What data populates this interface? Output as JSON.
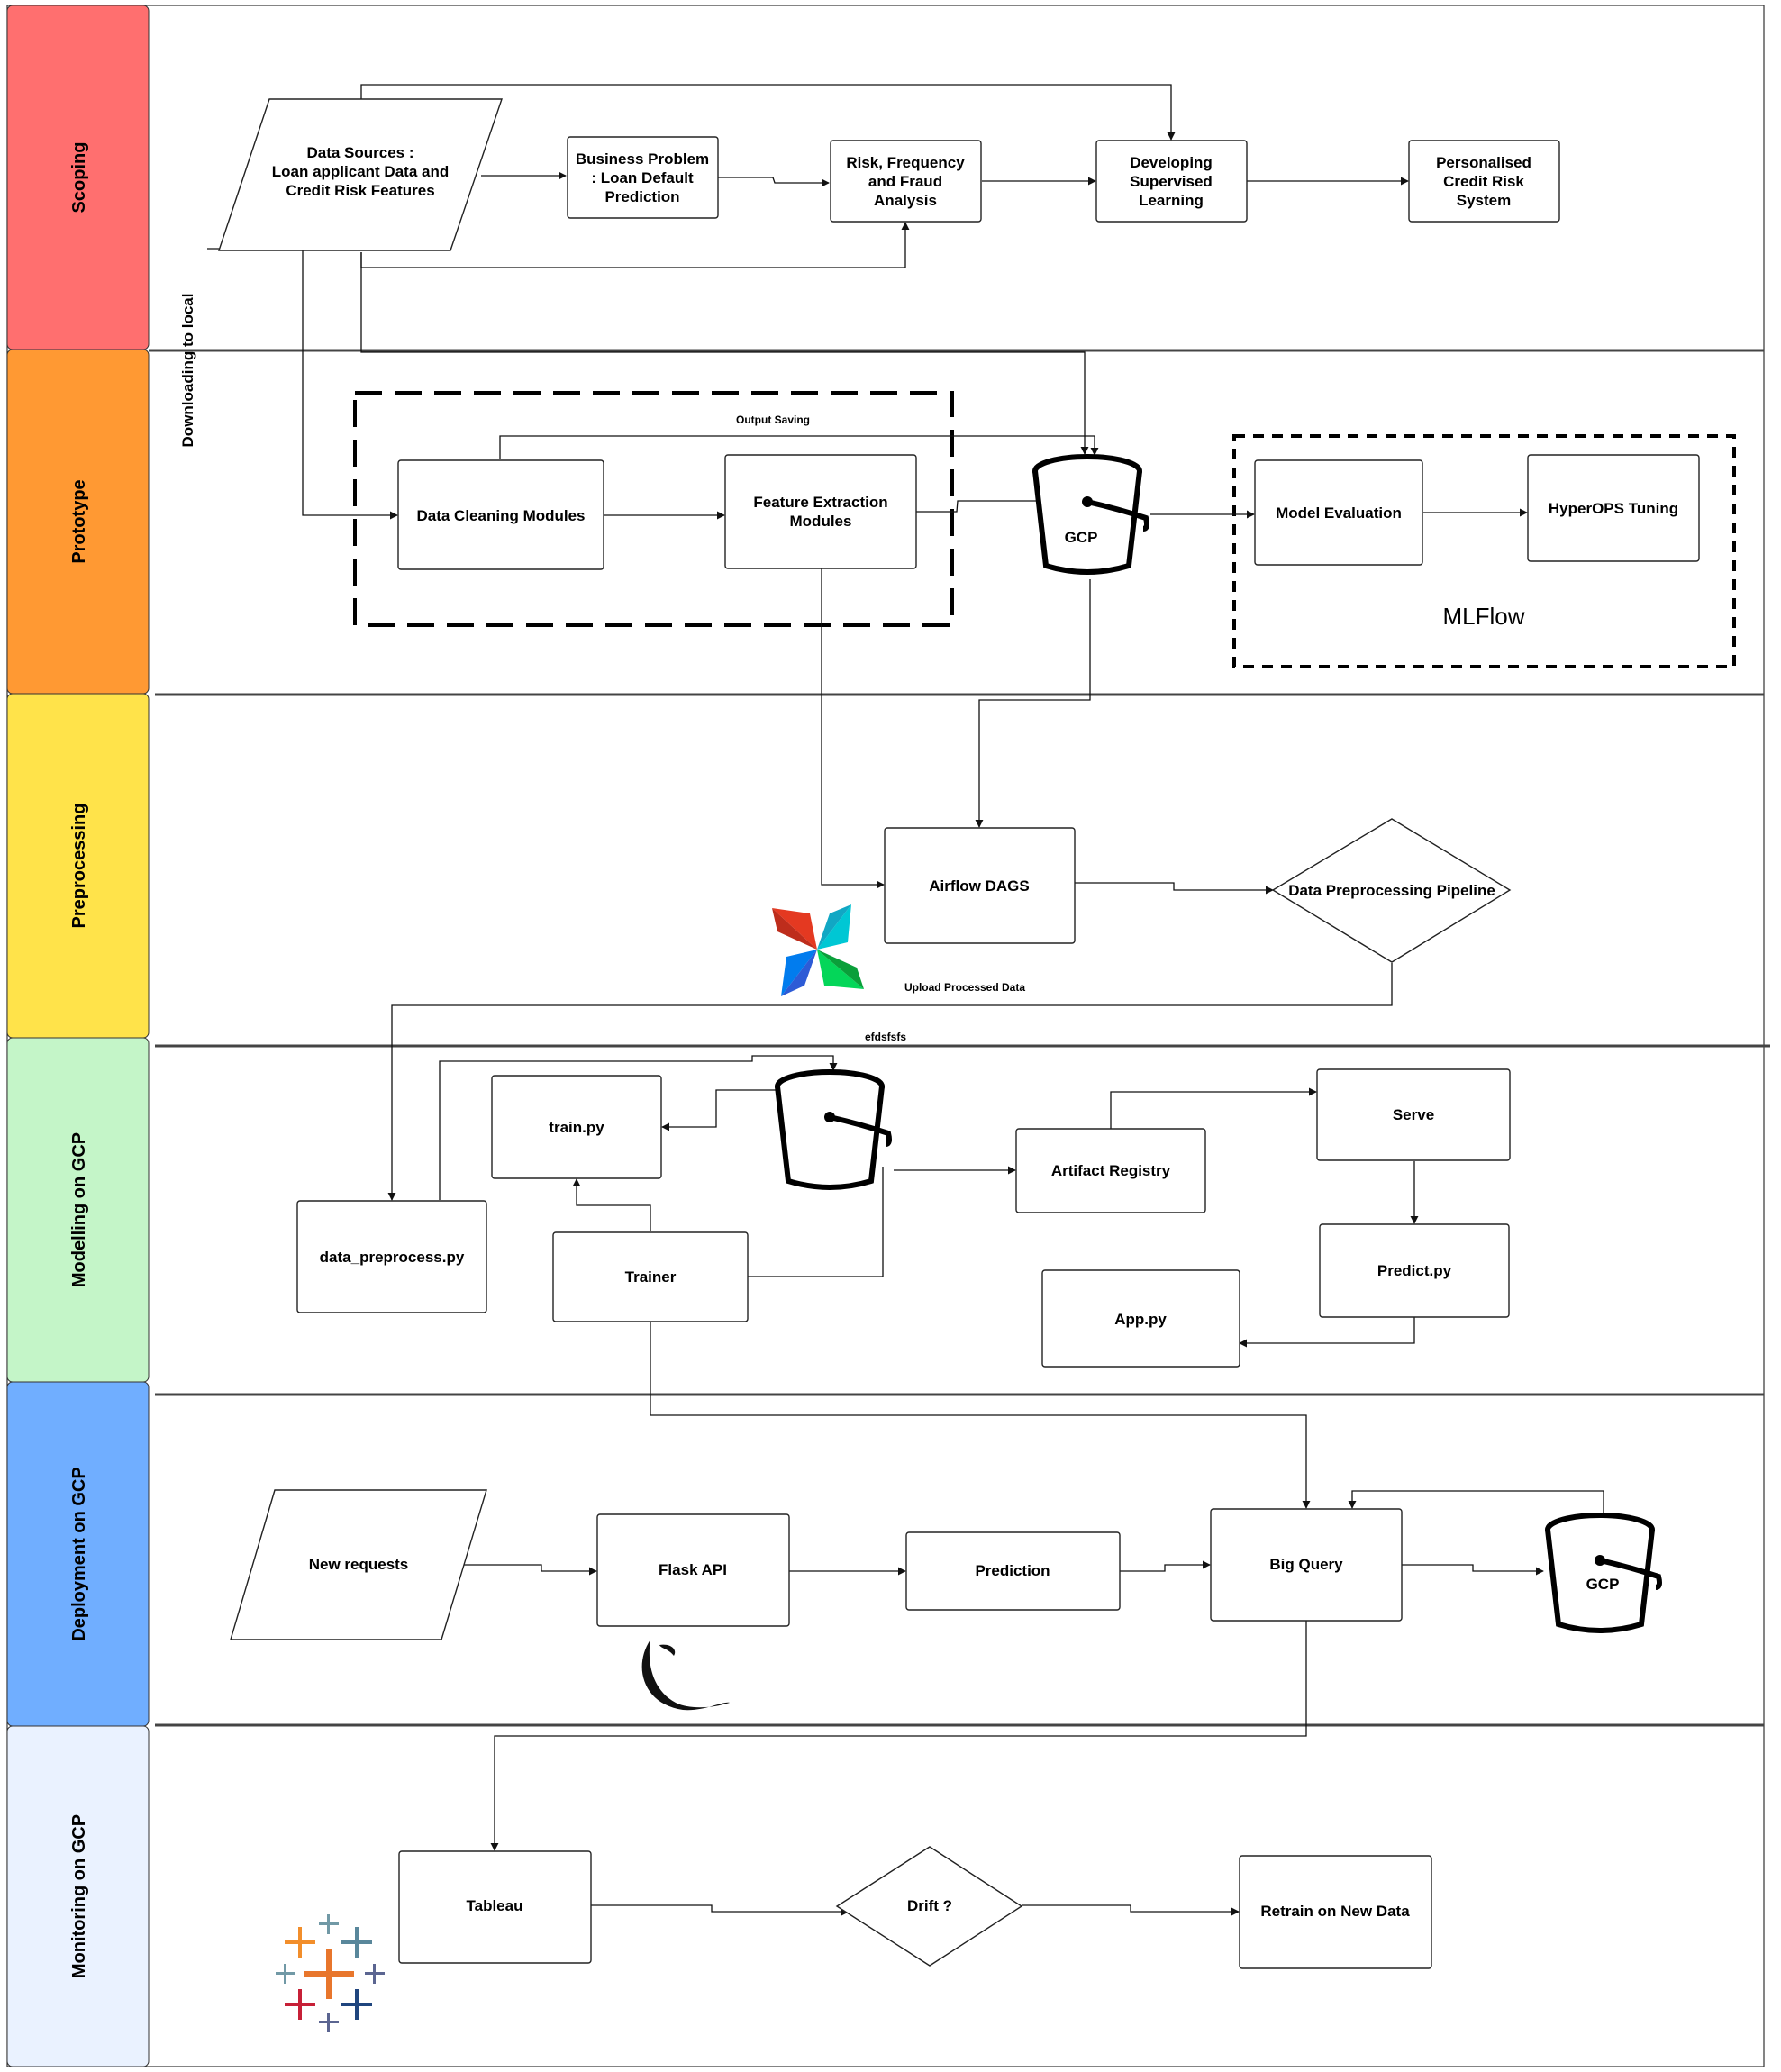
{
  "lanes": [
    {
      "id": "scoping",
      "label": "Scoping",
      "color": "#ff6f6f"
    },
    {
      "id": "prototype",
      "label": "Prototype",
      "color": "#ff9933"
    },
    {
      "id": "preprocessing",
      "label": "Preprocessing",
      "color": "#ffe34a"
    },
    {
      "id": "modelling",
      "label": "Modelling on GCP",
      "color": "#c4f5c8"
    },
    {
      "id": "deployment",
      "label": "Deployment on GCP",
      "color": "#70aeff"
    },
    {
      "id": "monitoring",
      "label": "Monitoring on GCP",
      "color": "#eaf2ff"
    }
  ],
  "nodes": {
    "data_sources": [
      "Data Sources :",
      "Loan applicant Data and",
      "Credit Risk Features"
    ],
    "business_problem": [
      "Business Problem",
      ": Loan Default",
      "Prediction"
    ],
    "risk_analysis": [
      "Risk, Frequency",
      "and Fraud",
      "Analysis"
    ],
    "supervised_learning": [
      "Developing",
      "Supervised",
      "Learning"
    ],
    "credit_risk_system": [
      "Personalised",
      "Credit Risk",
      "System"
    ],
    "data_cleaning": [
      "Data Cleaning Modules"
    ],
    "feature_extraction": [
      "Feature Extraction",
      "Modules"
    ],
    "gcp_bucket_1": [
      "GCP"
    ],
    "model_evaluation": [
      "Model Evaluation"
    ],
    "hyperops_tuning": [
      "HyperOPS Tuning"
    ],
    "airflow_dags": [
      "Airflow DAGS"
    ],
    "preprocessing_pipeline": [
      "Data Preprocessing Pipeline"
    ],
    "data_preprocess_py": [
      "data_preprocess.py"
    ],
    "train_py": [
      "train.py"
    ],
    "trainer": [
      "Trainer"
    ],
    "artifact_registry": [
      "Artifact Registry"
    ],
    "serve": [
      "Serve"
    ],
    "predict_py": [
      "Predict.py"
    ],
    "app_py": [
      "App.py"
    ],
    "new_requests": [
      "New requests"
    ],
    "flask_api": [
      "Flask API"
    ],
    "prediction": [
      "Prediction"
    ],
    "big_query": [
      "Big Query"
    ],
    "gcp_bucket_2": [
      "GCP"
    ],
    "tableau": [
      "Tableau"
    ],
    "drift": [
      "Drift ?"
    ],
    "retrain": [
      "Retrain on New Data"
    ]
  },
  "labels": {
    "downloading": "Downloading to local",
    "output_saving": "Output  Saving",
    "mlflow": "MLFlow",
    "upload_processed": "Upload Processed Data",
    "efdsfsfs": "efdsfsfs"
  },
  "icons": [
    "bucket-icon",
    "airflow-logo-icon",
    "flask-logo-icon",
    "tableau-logo-icon"
  ]
}
